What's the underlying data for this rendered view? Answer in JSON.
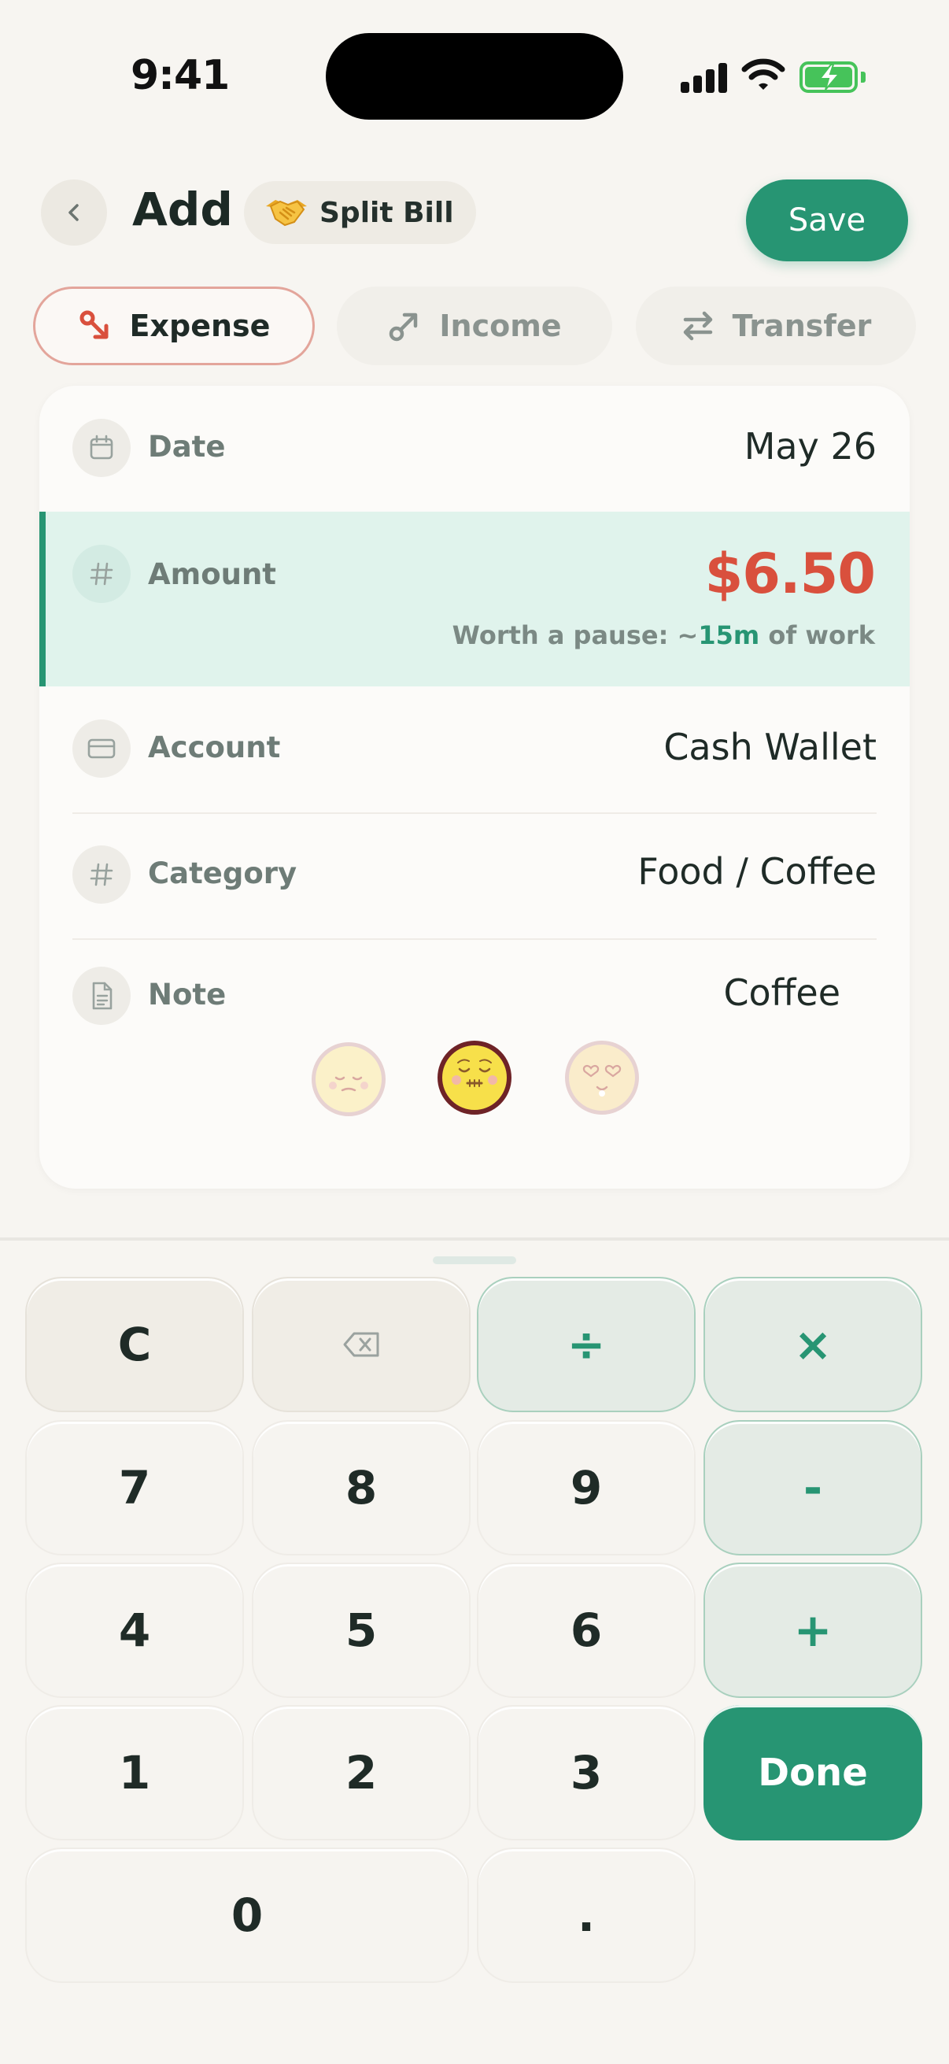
{
  "status_bar": {
    "time": "9:41"
  },
  "header": {
    "title": "Add",
    "split_bill_label": "Split Bill",
    "save_label": "Save"
  },
  "type_tabs": [
    {
      "label": "Expense",
      "active": true
    },
    {
      "label": "Income",
      "active": false
    },
    {
      "label": "Transfer",
      "active": false
    }
  ],
  "form": {
    "date": {
      "label": "Date",
      "value": "May 26"
    },
    "amount": {
      "label": "Amount",
      "value": "$6.50",
      "hint_prefix": "Worth a pause: ~",
      "hint_highlight": "15m",
      "hint_suffix": " of work"
    },
    "account": {
      "label": "Account",
      "value": "Cash Wallet"
    },
    "category": {
      "label": "Category",
      "value": "Food / Coffee"
    },
    "note": {
      "label": "Note",
      "value": "Coffee"
    },
    "moods": [
      {
        "icon": "sad-face-icon",
        "selected": false
      },
      {
        "icon": "content-face-icon",
        "selected": true
      },
      {
        "icon": "love-face-icon",
        "selected": false
      }
    ]
  },
  "keypad": {
    "clear": "C",
    "backspace_icon": "backspace-icon",
    "divide": "÷",
    "multiply": "×",
    "minus": "-",
    "plus": "+",
    "digits": [
      "7",
      "8",
      "9",
      "4",
      "5",
      "6",
      "1",
      "2",
      "3",
      "0"
    ],
    "decimal": ".",
    "done": "Done"
  },
  "colors": {
    "accent": "#279573",
    "expense_red": "#d9503d",
    "background": "#f7f5f1"
  }
}
